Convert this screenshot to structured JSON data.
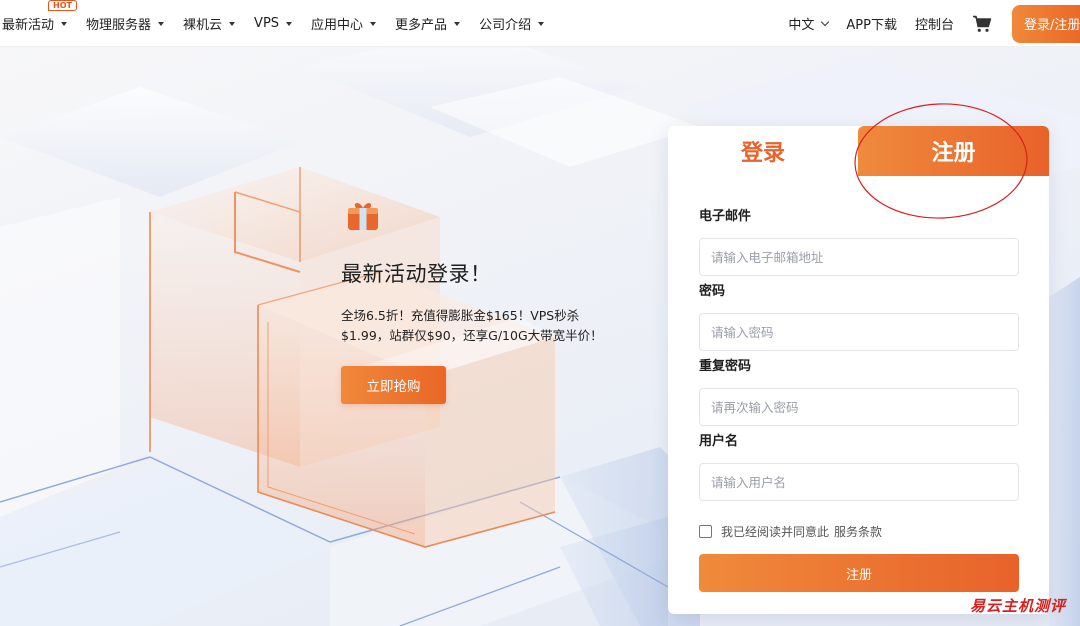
{
  "nav": {
    "items": [
      {
        "label": "最新活动",
        "badge": "HOT"
      },
      {
        "label": "物理服务器"
      },
      {
        "label": "裸机云"
      },
      {
        "label": "VPS"
      },
      {
        "label": "应用中心"
      },
      {
        "label": "更多产品"
      },
      {
        "label": "公司介绍"
      }
    ],
    "language": "中文",
    "app_download": "APP下载",
    "console": "控制台",
    "cart_icon": "shopping-cart-icon",
    "login_button": "登录/注册"
  },
  "promo": {
    "icon": "gift-icon",
    "title": "最新活动登录！",
    "desc_line1": "全场6.5折！充值得膨胀金$165！VPS秒杀",
    "desc_line2": "$1.99，站群仅$90，还享G/10G大带宽半价！",
    "button": "立即抢购"
  },
  "auth": {
    "tab_login": "登录",
    "tab_register": "注册",
    "active_tab": "注册",
    "fields": [
      {
        "label": "电子邮件",
        "placeholder": "请输入电子邮箱地址",
        "value": ""
      },
      {
        "label": "密码",
        "placeholder": "请输入密码",
        "value": ""
      },
      {
        "label": "重复密码",
        "placeholder": "请再次输入密码",
        "value": ""
      },
      {
        "label": "用户名",
        "placeholder": "请输入用户名",
        "value": ""
      }
    ],
    "agree_text": "我已经阅读并同意此",
    "agree_link": "服务条款",
    "agree_checked": false,
    "submit": "注册"
  },
  "watermark": "易云主机测评",
  "colors": {
    "accent": "#e8622a",
    "accent_light": "#f08a3b",
    "annotation": "#d82020"
  }
}
